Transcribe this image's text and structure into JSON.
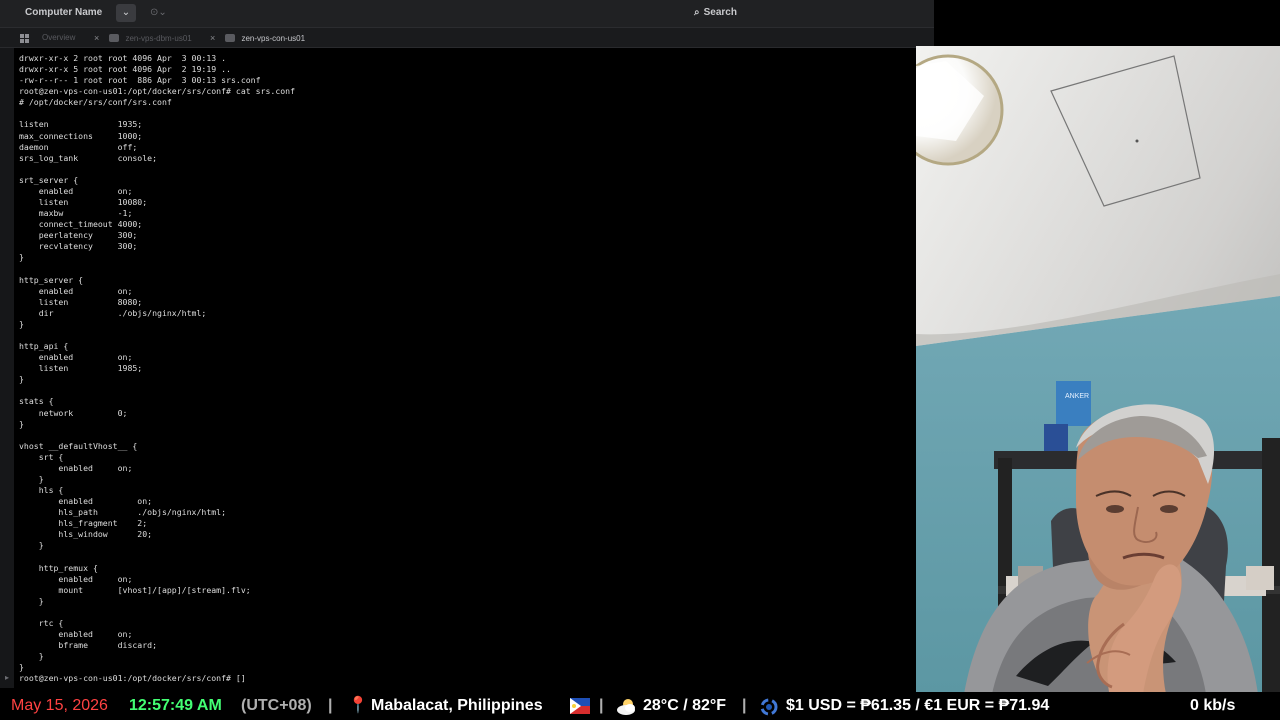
{
  "window": {
    "computer_name": "Computer Name",
    "search_label": "Search"
  },
  "icons": {
    "dropdown": "chevron-down-icon",
    "status": "status-icon",
    "search": "search-icon",
    "grid": "grid-icon",
    "close": "close-icon",
    "server_badge": "server-badge-icon"
  },
  "tabs": [
    {
      "label": "Overview",
      "active": false
    },
    {
      "label": "zen-vps-dbm-us01",
      "active": false
    },
    {
      "label": "zen-vps-con-us01",
      "active": true
    }
  ],
  "terminal": {
    "lines": [
      "drwxr-xr-x 2 root root 4096 Apr  3 00:13 .",
      "drwxr-xr-x 5 root root 4096 Apr  2 19:19 ..",
      "-rw-r--r-- 1 root root  886 Apr  3 00:13 srs.conf",
      "root@zen-vps-con-us01:/opt/docker/srs/conf# cat srs.conf",
      "# /opt/docker/srs/conf/srs.conf",
      "",
      "listen              1935;",
      "max_connections     1000;",
      "daemon              off;",
      "srs_log_tank        console;",
      "",
      "srt_server {",
      "    enabled         on;",
      "    listen          10080;",
      "    maxbw           -1;",
      "    connect_timeout 4000;",
      "    peerlatency     300;",
      "    recvlatency     300;",
      "}",
      "",
      "http_server {",
      "    enabled         on;",
      "    listen          8080;",
      "    dir             ./objs/nginx/html;",
      "}",
      "",
      "http_api {",
      "    enabled         on;",
      "    listen          1985;",
      "}",
      "",
      "stats {",
      "    network         0;",
      "}",
      "",
      "vhost __defaultVhost__ {",
      "    srt {",
      "        enabled     on;",
      "    }",
      "    hls {",
      "        enabled         on;",
      "        hls_path        ./objs/nginx/html;",
      "        hls_fragment    2;",
      "        hls_window      20;",
      "    }",
      "",
      "    http_remux {",
      "        enabled     on;",
      "        mount       [vhost]/[app]/[stream].flv;",
      "    }",
      "",
      "    rtc {",
      "        enabled     on;",
      "        bframe      discard;",
      "    }",
      "}",
      "root@zen-vps-con-us01:/opt/docker/srs/conf# []"
    ]
  },
  "webcam": {
    "visible_text": "ANKER"
  },
  "ticker": {
    "date": "May 15, 2026",
    "time": "12:57:49 AM",
    "timezone": "(UTC+08)",
    "separator": "|",
    "location": "Mabalacat, Philippines",
    "weather": "28°C / 82°F",
    "exchange_rate": "$1 USD = ₱61.35 / €1 EUR = ₱71.94",
    "network_speed": "0 kb/s",
    "icons": {
      "pin": "location-pin-icon",
      "flag": "philippines-flag-icon",
      "weather": "partly-cloudy-icon",
      "currency": "currency-exchange-icon"
    },
    "colors": {
      "date": "#ff4242",
      "time": "#43ff73",
      "muted": "#b0b0b0"
    }
  }
}
